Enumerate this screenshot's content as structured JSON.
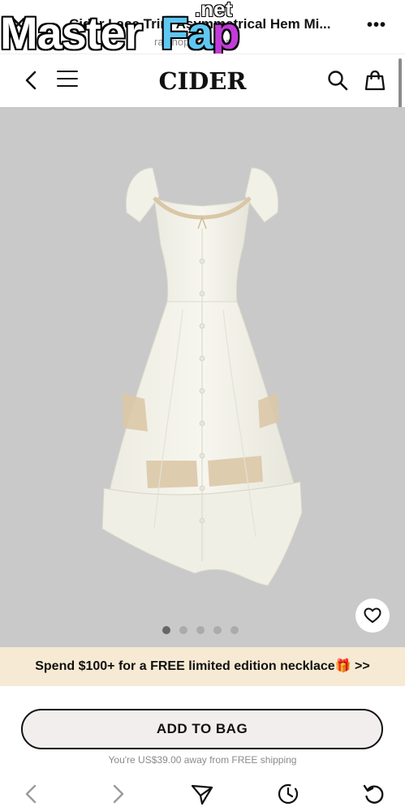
{
  "browser": {
    "title": "Cider Lace Trim Asymmetrical Hem Mi...",
    "url": "ra.shopcider.com",
    "close_icon": "close-icon",
    "more_icon": "more-icon",
    "more_label": "•••"
  },
  "watermark": {
    "master": "Master",
    "fa": "Fa",
    "p": "p",
    "net": ".net"
  },
  "header": {
    "logo": "CIDER",
    "back_icon": "chevron-left-icon",
    "menu_icon": "hamburger-icon",
    "search_icon": "search-icon",
    "bag_icon": "shopping-bag-icon"
  },
  "gallery": {
    "image_count": 5,
    "active_index": 0,
    "favorite_icon": "heart-icon",
    "background": "#c9c9c9"
  },
  "promo": {
    "text": "Spend $100+ for a FREE limited edition necklace🎁 >>",
    "background": "#f6ead4"
  },
  "cta": {
    "add_to_bag": "ADD TO BAG",
    "shipping_note": "You're US$39.00 away from FREE shipping"
  },
  "bottom_nav": {
    "back_icon": "chevron-left-icon",
    "forward_icon": "chevron-right-icon",
    "share_icon": "send-icon",
    "history_icon": "history-icon",
    "reload_icon": "reload-icon"
  }
}
